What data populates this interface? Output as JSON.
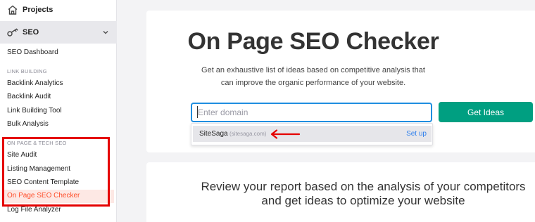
{
  "sidebar": {
    "projects_label": "Projects",
    "seo_label": "SEO",
    "seo_dashboard": "SEO Dashboard",
    "link_building_header": "LINK BUILDING",
    "link_building_items": [
      "Backlink Analytics",
      "Backlink Audit",
      "Link Building Tool",
      "Bulk Analysis"
    ],
    "onpage_header": "ON PAGE & TECH SEO",
    "onpage_items": [
      "Site Audit",
      "Listing Management",
      "SEO Content Template",
      "On Page SEO Checker",
      "Log File Analyzer"
    ],
    "active_item": "On Page SEO Checker",
    "icons": {
      "projects": "home-icon",
      "seo": "key-icon",
      "expand": "chevron-down-icon"
    }
  },
  "main": {
    "title": "On Page SEO Checker",
    "subtitle": "Get an exhaustive list of ideas based on competitive analysis that can improve the organic performance of your website.",
    "domain_placeholder": "Enter domain",
    "get_ideas_label": "Get Ideas",
    "suggestion": {
      "name": "SiteSaga",
      "domain": "(sitesaga.com)",
      "action": "Set up"
    },
    "bottom_heading": "Review your report based on the analysis of your competitors and get ideas to optimize your website"
  },
  "colors": {
    "accent_orange": "#ff4e2a",
    "button_green": "#009f81",
    "focus_blue": "#1f8ee0",
    "annotation_red": "#e50000",
    "link_blue": "#2f80ed"
  }
}
